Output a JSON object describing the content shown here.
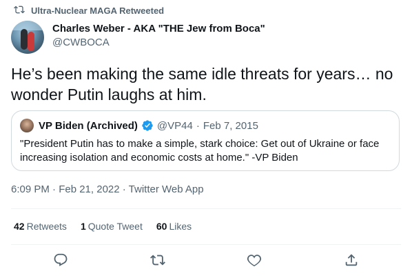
{
  "retweet": {
    "icon": "retweet-icon",
    "text": "Ultra-Nuclear MAGA Retweeted"
  },
  "author": {
    "name": "Charles Weber - AKA \"THE Jew from Boca\"",
    "handle": "@CWBOCA",
    "avatar_icon": "avatar"
  },
  "tweet": {
    "text": "He’s been making the same idle threats for years… no wonder Putin laughs at him."
  },
  "quote": {
    "name": "VP Biden (Archived)",
    "verified_icon": "verified-badge-icon",
    "handle": "@VP44",
    "dot": "·",
    "date": "Feb 7, 2015",
    "text": "\"President Putin has to make a simple, stark choice: Get out of Ukraine or face increasing isolation and economic costs at home.\" -VP Biden"
  },
  "meta": {
    "text": "6:09 PM · Feb 21, 2022 · Twitter Web App"
  },
  "stats": {
    "retweets_count": "42",
    "retweets_label": "Retweets",
    "quotes_count": "1",
    "quotes_label": "Quote Tweet",
    "likes_count": "60",
    "likes_label": "Likes"
  },
  "actions": [
    "reply-icon",
    "retweet-icon",
    "like-icon",
    "share-icon"
  ],
  "colors": {
    "text_primary": "#0f1419",
    "text_secondary": "#536471",
    "border": "#cfd9de",
    "divider": "#eff3f4",
    "verified_blue": "#1d9bf0"
  }
}
